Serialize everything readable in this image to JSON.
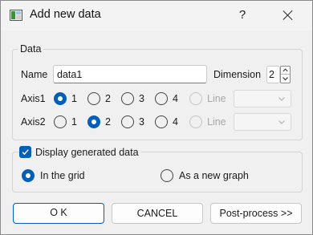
{
  "window": {
    "title": "Add new data",
    "help_label": "?"
  },
  "data_group": {
    "legend": "Data",
    "name_label": "Name",
    "name_value": "data1",
    "dimension_label": "Dimension",
    "dimension_value": "2",
    "axis1": {
      "label": "Axis1",
      "options": [
        "1",
        "2",
        "3",
        "4"
      ],
      "selected": "1",
      "line_label": "Line",
      "line_enabled": false,
      "combo_value": ""
    },
    "axis2": {
      "label": "Axis2",
      "options": [
        "1",
        "2",
        "3",
        "4"
      ],
      "selected": "2",
      "line_label": "Line",
      "line_enabled": false,
      "combo_value": ""
    }
  },
  "display_group": {
    "checkbox_label": "Display generated data",
    "checked": true,
    "option_grid": "In the grid",
    "option_new_graph": "As a new graph",
    "selected": "In the grid"
  },
  "buttons": {
    "ok": "O K",
    "cancel": "CANCEL",
    "post_process": "Post-process >>"
  },
  "colors": {
    "accent": "#005fb8",
    "window_bg": "#f0f0f0",
    "disabled_text": "#a8a8a8"
  }
}
